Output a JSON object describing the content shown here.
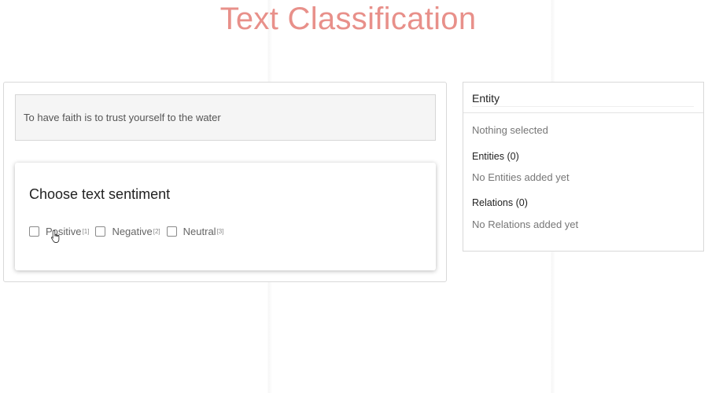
{
  "page": {
    "title": "Text Classification"
  },
  "task": {
    "text": "To have faith is to trust yourself to the water",
    "question": "Choose text sentiment",
    "options": [
      {
        "label": "Positive",
        "hotkey": "[1]",
        "checked": false
      },
      {
        "label": "Negative",
        "hotkey": "[2]",
        "checked": false
      },
      {
        "label": "Neutral",
        "hotkey": "[3]",
        "checked": false
      }
    ]
  },
  "sidebar": {
    "header": "Entity",
    "selection_status": "Nothing selected",
    "entities_title": "Entities (0)",
    "entities_empty": "No Entities added yet",
    "relations_title": "Relations (0)",
    "relations_empty": "No Relations added yet"
  },
  "icons": {
    "cursor": "hand-pointer-icon"
  },
  "colors": {
    "title": "#e8908a"
  }
}
